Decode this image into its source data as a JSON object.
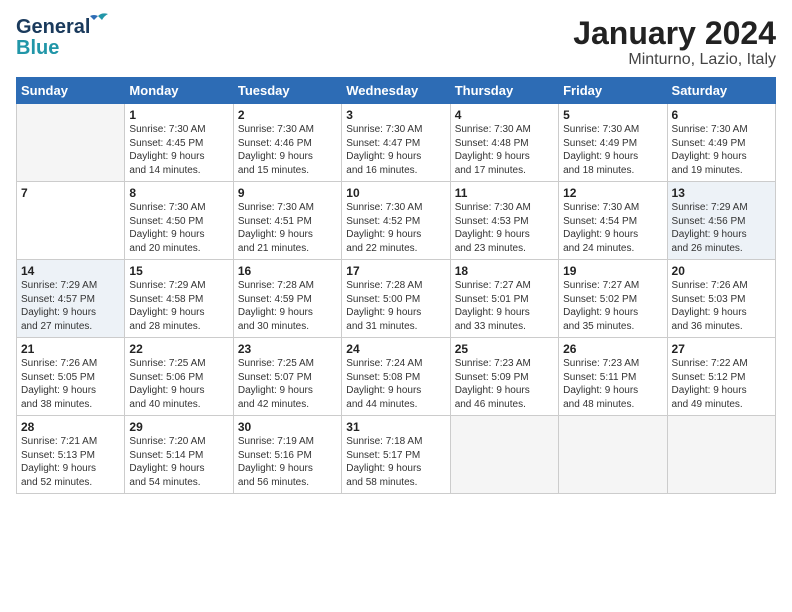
{
  "header": {
    "logo_line1": "General",
    "logo_line2": "Blue",
    "title": "January 2024",
    "subtitle": "Minturno, Lazio, Italy"
  },
  "columns": [
    "Sunday",
    "Monday",
    "Tuesday",
    "Wednesday",
    "Thursday",
    "Friday",
    "Saturday"
  ],
  "weeks": [
    [
      {
        "day": "",
        "info": "",
        "empty": true
      },
      {
        "day": "1",
        "info": "Sunrise: 7:30 AM\nSunset: 4:45 PM\nDaylight: 9 hours\nand 14 minutes."
      },
      {
        "day": "2",
        "info": "Sunrise: 7:30 AM\nSunset: 4:46 PM\nDaylight: 9 hours\nand 15 minutes."
      },
      {
        "day": "3",
        "info": "Sunrise: 7:30 AM\nSunset: 4:47 PM\nDaylight: 9 hours\nand 16 minutes."
      },
      {
        "day": "4",
        "info": "Sunrise: 7:30 AM\nSunset: 4:48 PM\nDaylight: 9 hours\nand 17 minutes."
      },
      {
        "day": "5",
        "info": "Sunrise: 7:30 AM\nSunset: 4:49 PM\nDaylight: 9 hours\nand 18 minutes."
      },
      {
        "day": "6",
        "info": "Sunrise: 7:30 AM\nSunset: 4:49 PM\nDaylight: 9 hours\nand 19 minutes."
      }
    ],
    [
      {
        "day": "7",
        "info": ""
      },
      {
        "day": "8",
        "info": "Sunrise: 7:30 AM\nSunset: 4:50 PM\nDaylight: 9 hours\nand 20 minutes."
      },
      {
        "day": "9",
        "info": "Sunrise: 7:30 AM\nSunset: 4:51 PM\nDaylight: 9 hours\nand 21 minutes."
      },
      {
        "day": "10",
        "info": "Sunrise: 7:30 AM\nSunset: 4:52 PM\nDaylight: 9 hours\nand 22 minutes."
      },
      {
        "day": "11",
        "info": "Sunrise: 7:30 AM\nSunset: 4:53 PM\nDaylight: 9 hours\nand 23 minutes."
      },
      {
        "day": "12",
        "info": "Sunrise: 7:30 AM\nSunset: 4:54 PM\nDaylight: 9 hours\nand 24 minutes."
      },
      {
        "day": "13",
        "info": "Sunrise: 7:29 AM\nSunset: 4:56 PM\nDaylight: 9 hours\nand 26 minutes.",
        "shade": true
      }
    ],
    [
      {
        "day": "14",
        "info": "Sunrise: 7:29 AM\nSunset: 4:57 PM\nDaylight: 9 hours\nand 27 minutes.",
        "shade": true
      },
      {
        "day": "15",
        "info": "Sunrise: 7:29 AM\nSunset: 4:58 PM\nDaylight: 9 hours\nand 28 minutes."
      },
      {
        "day": "16",
        "info": "Sunrise: 7:28 AM\nSunset: 4:59 PM\nDaylight: 9 hours\nand 30 minutes."
      },
      {
        "day": "17",
        "info": "Sunrise: 7:28 AM\nSunset: 5:00 PM\nDaylight: 9 hours\nand 31 minutes."
      },
      {
        "day": "18",
        "info": "Sunrise: 7:27 AM\nSunset: 5:01 PM\nDaylight: 9 hours\nand 33 minutes."
      },
      {
        "day": "19",
        "info": "Sunrise: 7:27 AM\nSunset: 5:02 PM\nDaylight: 9 hours\nand 35 minutes."
      },
      {
        "day": "20",
        "info": "Sunrise: 7:26 AM\nSunset: 5:03 PM\nDaylight: 9 hours\nand 36 minutes."
      }
    ],
    [
      {
        "day": "21",
        "info": "Sunrise: 7:26 AM\nSunset: 5:05 PM\nDaylight: 9 hours\nand 38 minutes."
      },
      {
        "day": "22",
        "info": "Sunrise: 7:25 AM\nSunset: 5:06 PM\nDaylight: 9 hours\nand 40 minutes."
      },
      {
        "day": "23",
        "info": "Sunrise: 7:25 AM\nSunset: 5:07 PM\nDaylight: 9 hours\nand 42 minutes."
      },
      {
        "day": "24",
        "info": "Sunrise: 7:24 AM\nSunset: 5:08 PM\nDaylight: 9 hours\nand 44 minutes."
      },
      {
        "day": "25",
        "info": "Sunrise: 7:23 AM\nSunset: 5:09 PM\nDaylight: 9 hours\nand 46 minutes."
      },
      {
        "day": "26",
        "info": "Sunrise: 7:23 AM\nSunset: 5:11 PM\nDaylight: 9 hours\nand 48 minutes."
      },
      {
        "day": "27",
        "info": "Sunrise: 7:22 AM\nSunset: 5:12 PM\nDaylight: 9 hours\nand 49 minutes."
      }
    ],
    [
      {
        "day": "28",
        "info": "Sunrise: 7:21 AM\nSunset: 5:13 PM\nDaylight: 9 hours\nand 52 minutes."
      },
      {
        "day": "29",
        "info": "Sunrise: 7:20 AM\nSunset: 5:14 PM\nDaylight: 9 hours\nand 54 minutes."
      },
      {
        "day": "30",
        "info": "Sunrise: 7:19 AM\nSunset: 5:16 PM\nDaylight: 9 hours\nand 56 minutes."
      },
      {
        "day": "31",
        "info": "Sunrise: 7:18 AM\nSunset: 5:17 PM\nDaylight: 9 hours\nand 58 minutes."
      },
      {
        "day": "",
        "info": "",
        "empty": true
      },
      {
        "day": "",
        "info": "",
        "empty": true
      },
      {
        "day": "",
        "info": "",
        "empty": true
      }
    ]
  ]
}
